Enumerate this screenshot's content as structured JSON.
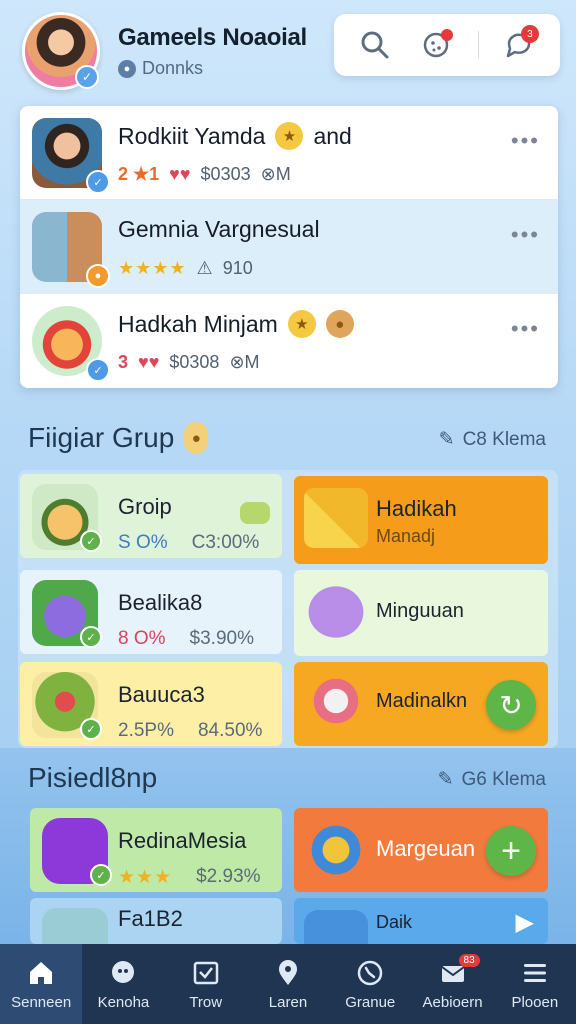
{
  "header": {
    "title": "Gameels Noaoial",
    "subtitle": "Donnks",
    "toolbar_badge": "3"
  },
  "contacts": [
    {
      "name": "Rodkiit Yamda",
      "suffix": "and",
      "rank": "2 ★1",
      "hearts": "♥♥",
      "score": "$0303",
      "members": "⊗M"
    },
    {
      "name": "Gemnia Vargnesual",
      "stars": "★★★★",
      "triangle": "⚠",
      "score": "910"
    },
    {
      "name": "Hadkah Minjam",
      "rank": "3",
      "hearts": "♥♥",
      "score": "$0308",
      "members": "⊗M"
    }
  ],
  "section1": {
    "title": "Fiigiar Grup",
    "link": "C8 Klema"
  },
  "tiles": [
    {
      "name": "Groip",
      "stat1": "S O%",
      "stat2": "C3:00%"
    },
    {
      "name": "Hadikah",
      "sub": "Manadj"
    },
    {
      "name": "Bealika8",
      "stat1": "8 O%",
      "stat2": "$3.90%"
    },
    {
      "name": "Minguuan"
    },
    {
      "name": "Bauuca3",
      "stat1": "2.5P%",
      "stat2": "84.50%"
    },
    {
      "name": "Madinalkn"
    },
    {
      "name": "RedinaMesia",
      "stars": "★★★",
      "stat2": "$2.93%"
    },
    {
      "name": "Margeuan"
    },
    {
      "name": "Fa1B2"
    },
    {
      "name": "Daik"
    }
  ],
  "section2": {
    "title": "Pisiedl8np",
    "link": "G6 Klema"
  },
  "nav": [
    {
      "label": "Senneen",
      "icon": "home-icon"
    },
    {
      "label": "Kenoha",
      "icon": "chat-icon"
    },
    {
      "label": "Trow",
      "icon": "inbox-icon"
    },
    {
      "label": "Laren",
      "icon": "location-icon"
    },
    {
      "label": "Granue",
      "icon": "phone-icon"
    },
    {
      "label": "Aebioern",
      "icon": "mail-icon",
      "badge": "83"
    },
    {
      "label": "Plooen",
      "icon": "menu-icon"
    }
  ],
  "colors": {
    "accent_green": "#5db647",
    "accent_orange": "#f59d1b",
    "nav_bg": "#1f3552",
    "badge_red": "#e53a3a"
  }
}
